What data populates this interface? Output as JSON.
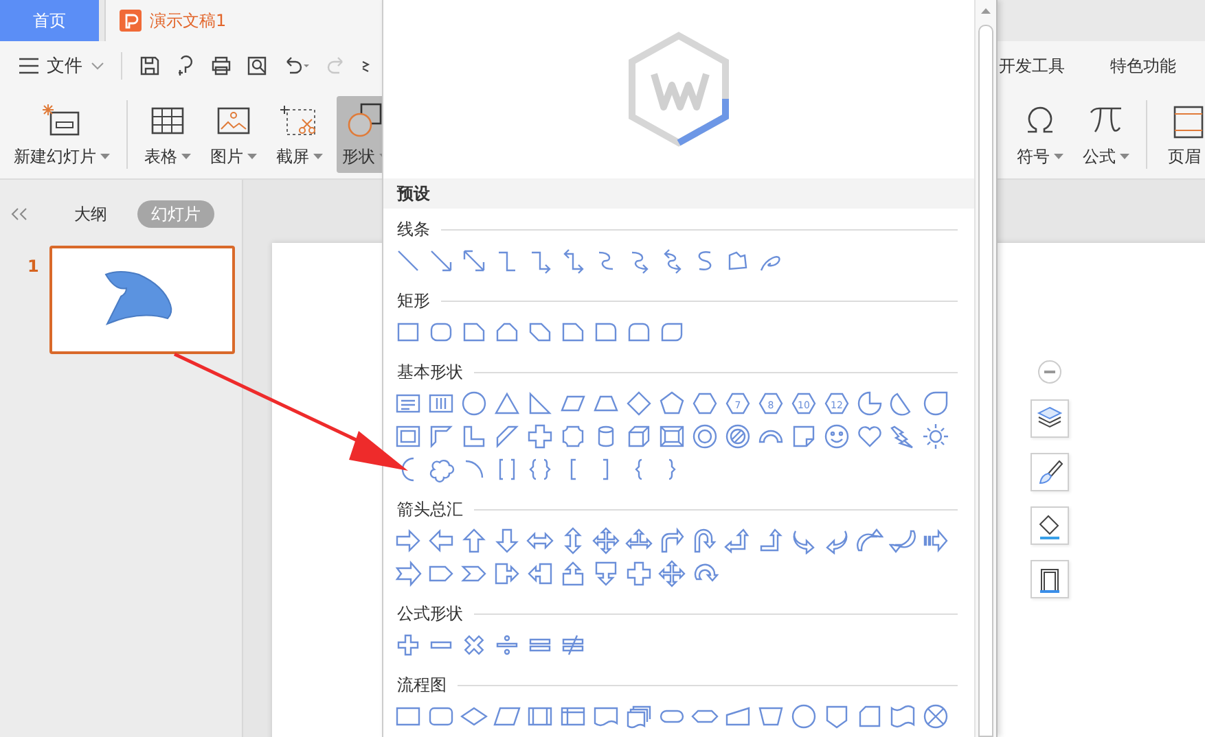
{
  "tabs": [
    {
      "label": "首页",
      "selected": false
    },
    {
      "label": "演示文稿1",
      "selected": true
    }
  ],
  "menu": {
    "label": "文件"
  },
  "quick_access": {
    "redo_disabled": true
  },
  "ribbon_tabs": [
    "开发工具",
    "特色功能"
  ],
  "ribbon_left": [
    {
      "label": "新建幻灯片",
      "selected": false
    },
    {
      "label": "表格",
      "selected": false
    },
    {
      "label": "图片",
      "selected": false
    },
    {
      "label": "截屏",
      "selected": false
    },
    {
      "label": "形状",
      "selected": true
    }
  ],
  "ribbon_right": [
    {
      "label": "符号"
    },
    {
      "label": "公式"
    },
    {
      "label": "页眉"
    }
  ],
  "panel": {
    "tabs": [
      {
        "label": "大纲",
        "selected": false
      },
      {
        "label": "幻灯片",
        "selected": true
      }
    ],
    "slides": [
      {
        "number": "1",
        "selected": true
      }
    ]
  },
  "shapes_menu": {
    "heading": "预设",
    "sections": [
      {
        "title": "线条"
      },
      {
        "title": "矩形"
      },
      {
        "title": "基本形状",
        "numbers": [
          "7",
          "8",
          "10",
          "12"
        ]
      },
      {
        "title": "箭头总汇"
      },
      {
        "title": "公式形状"
      },
      {
        "title": "流程图"
      }
    ]
  }
}
